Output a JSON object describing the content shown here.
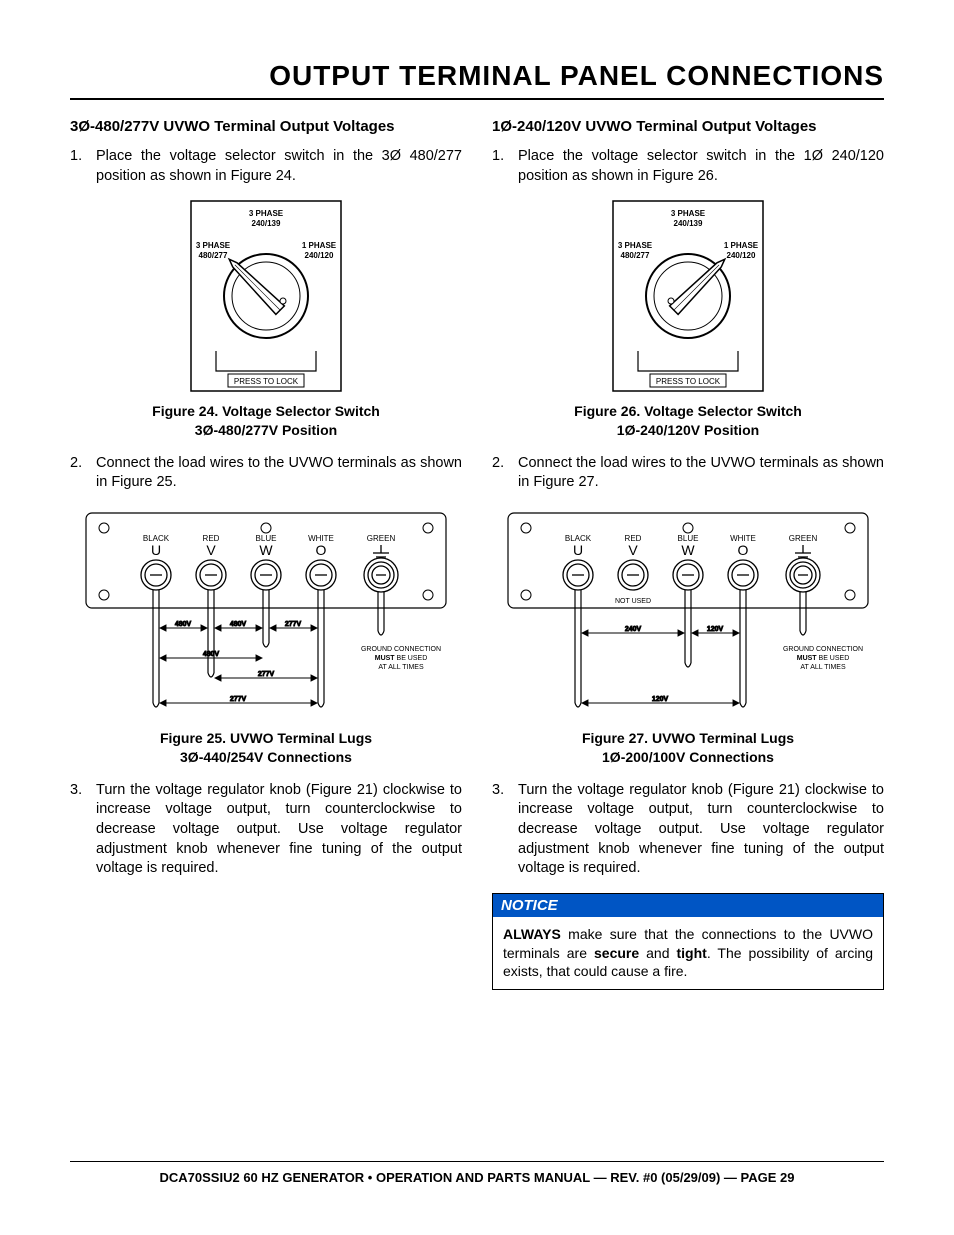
{
  "title": "OUTPUT TERMINAL PANEL CONNECTIONS",
  "left": {
    "heading": "3Ø-480/277V UVWO Terminal Output Voltages",
    "step1": "Place the voltage selector switch in the 3Ø 480/277 position as shown in Figure 24.",
    "fig24_caption1": "Figure 24. Voltage Selector Switch",
    "fig24_caption2": "3Ø-480/277V Position",
    "step2": "Connect the load wires to the UVWO terminals as shown in Figure 25.",
    "fig25_caption1": "Figure 25. UVWO Terminal Lugs",
    "fig25_caption2": "3Ø-440/254V Connections",
    "step3": "Turn the voltage regulator knob (Figure 21) clockwise to increase voltage output, turn counterclockwise to decrease voltage output. Use voltage regulator adjustment knob whenever fine tuning of the output voltage is required."
  },
  "right": {
    "heading": "1Ø-240/120V UVWO Terminal Output Voltages",
    "step1": "Place the voltage selector switch in the 1Ø 240/120 position as shown in Figure 26.",
    "fig26_caption1": "Figure 26. Voltage Selector Switch",
    "fig26_caption2": "1Ø-240/120V Position",
    "step2": "Connect the load wires to the UVWO terminals as shown in Figure 27.",
    "fig27_caption1": "Figure 27. UVWO Terminal Lugs",
    "fig27_caption2": "1Ø-200/100V Connections",
    "step3": "Turn the voltage regulator knob (Figure 21) clockwise to increase voltage output, turn counterclockwise to decrease voltage output. Use voltage regulator adjustment knob whenever fine tuning of the output voltage is required."
  },
  "notice": {
    "header": "NOTICE",
    "body_strong1": "ALWAYS",
    "body_mid1": " make sure that the connections to the UVWO terminals are ",
    "body_strong2": "secure",
    "body_mid2": " and ",
    "body_strong3": "tight",
    "body_end": ". The possibility of arcing exists, that could cause a fire."
  },
  "switch_labels": {
    "top": "3 PHASE",
    "top2": "240/139",
    "left": "3 PHASE",
    "left2": "480/277",
    "right": "1 PHASE",
    "right2": "240/120",
    "lock": "PRESS TO LOCK"
  },
  "terminal_labels": {
    "colors": [
      "BLACK",
      "RED",
      "BLUE",
      "WHITE",
      "GREEN"
    ],
    "letters": [
      "U",
      "V",
      "W",
      "O"
    ],
    "ground1": "GROUND CONNECTION",
    "ground2": "MUST",
    "ground3": " BE USED",
    "ground4": "AT ALL TIMES",
    "v480": "480V",
    "v277": "277V",
    "v240": "240V",
    "v120": "120V",
    "not_used": "NOT USED"
  },
  "footer": "DCA70SSIU2 60 HZ GENERATOR • OPERATION AND PARTS MANUAL — REV. #0 (05/29/09) — PAGE 29"
}
